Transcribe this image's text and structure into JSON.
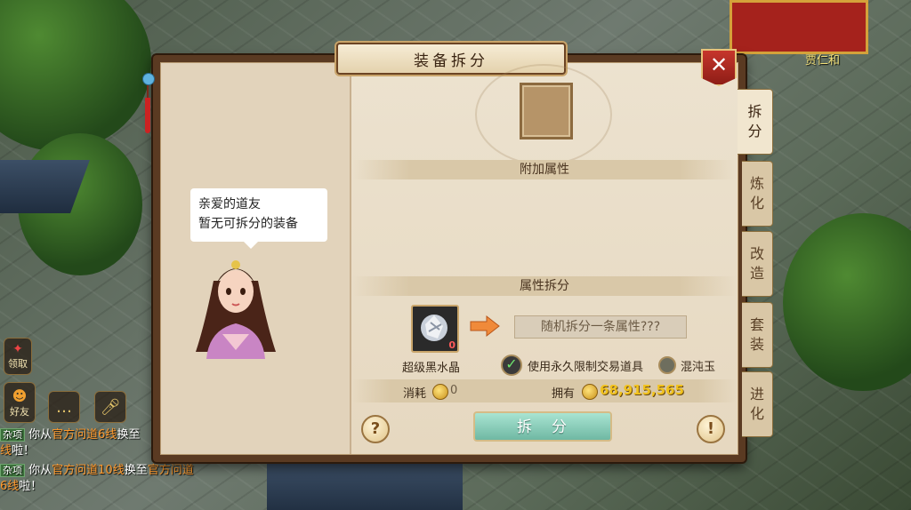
{
  "dialog": {
    "title": "装备拆分",
    "close_label": "✕",
    "npc_message_line1": "亲爱的道友",
    "npc_message_line2": "暂无可拆分的装备"
  },
  "tabs": [
    {
      "label": "拆分",
      "active": true
    },
    {
      "label": "炼化"
    },
    {
      "label": "改造"
    },
    {
      "label": "套装"
    },
    {
      "label": "进化"
    }
  ],
  "sections": {
    "extra_attributes": "附加属性",
    "attribute_split": "属性拆分"
  },
  "split": {
    "material_name": "超级黑水晶",
    "material_count": "0",
    "result_text": "随机拆分一条属性???",
    "use_permanent_label": "使用永久限制交易道具",
    "alt_material_label": "混沌玉",
    "cost_label": "消耗",
    "cost_value": "0",
    "owned_label": "拥有",
    "owned_value": "68,915,565",
    "button_label": "拆分",
    "help_label": "?",
    "info_label": "!"
  },
  "world": {
    "npc_name": "贾仁和"
  },
  "hud": {
    "friends_label": "好友",
    "receive_label": "领取"
  },
  "chat": [
    {
      "tag": "杂项",
      "pre": "你从",
      "hl1": "官方问道6线",
      "mid": "换至",
      "hl2": "",
      "post": "",
      "line2_hl": "线",
      "line2": "啦！"
    },
    {
      "tag": "杂项",
      "pre": "你从",
      "hl1": "官方问道10线",
      "mid": "换至",
      "hl2": "官方问道",
      "post": "",
      "line2_hl": "6线",
      "line2": "啦！"
    }
  ],
  "colors": {
    "accent_gold": "#f1c21e",
    "button_teal": "#6fb8a3",
    "close_red": "#c6362c"
  }
}
